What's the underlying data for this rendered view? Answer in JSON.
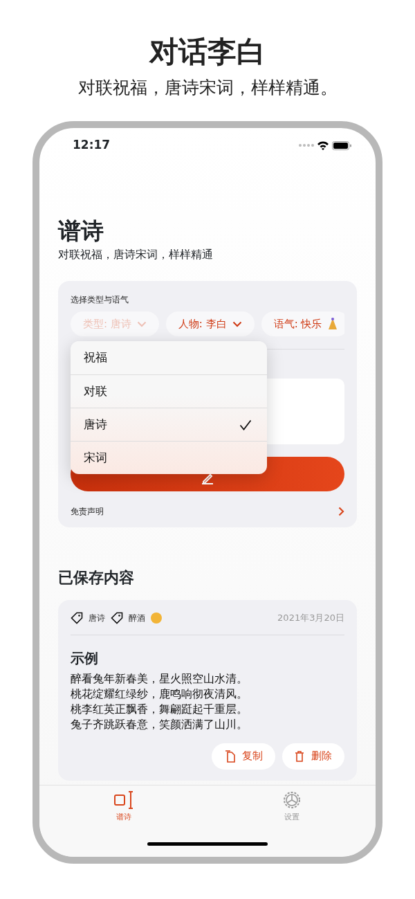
{
  "header": {
    "title": "对话李白",
    "subtitle": "对联祝福，唐诗宋词，样样精通。"
  },
  "status_bar": {
    "time": "12:17"
  },
  "page": {
    "title": "谱诗",
    "subtitle": "对联祝福，唐诗宋词，样样精通"
  },
  "composer": {
    "label": "选择类型与语气",
    "chips": [
      {
        "label": "类型: 唐诗",
        "disabled": true,
        "kind": "chevron"
      },
      {
        "label": "人物: 李白",
        "disabled": false,
        "kind": "chevron"
      },
      {
        "label": "语气: 快乐",
        "disabled": false,
        "kind": "party"
      }
    ],
    "disclaimer": "免责声明"
  },
  "type_menu": {
    "options": [
      {
        "label": "祝福",
        "selected": false
      },
      {
        "label": "对联",
        "selected": false
      },
      {
        "label": "唐诗",
        "selected": true
      },
      {
        "label": "宋词",
        "selected": false
      }
    ]
  },
  "saved": {
    "title": "已保存内容",
    "items": [
      {
        "tags": [
          {
            "label": "唐诗",
            "kind": "plain"
          },
          {
            "label": "醉酒",
            "kind": "emoji"
          }
        ],
        "date": "2021年3月20日",
        "title": "示例",
        "lines": [
          "醉看兔年新春美，星火照空山水清。",
          "桃花绽耀红绿纱，鹿鸣响彻夜清风。",
          "桃李红英正飘香，舞翩跹起千重层。",
          "兔子齐跳跃春意，笑颜洒满了山川。"
        ],
        "actions": [
          {
            "label": "复制",
            "kind": "copy"
          },
          {
            "label": "删除",
            "kind": "delete"
          }
        ]
      }
    ]
  },
  "tab_bar": [
    {
      "label": "谱诗",
      "selected": true,
      "kind": "compose"
    },
    {
      "label": "设置",
      "selected": false,
      "kind": "settings"
    }
  ]
}
